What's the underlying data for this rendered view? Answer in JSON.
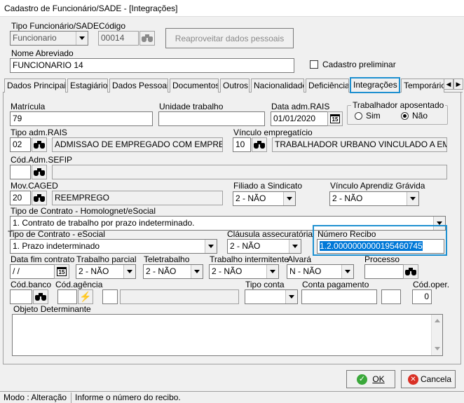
{
  "window": {
    "title": "Cadastro de Funcionário/SADE - [Integrações]"
  },
  "header": {
    "tipo_label": "Tipo Funcionário/SADE",
    "tipo_value": "Funcionario",
    "codigo_label": "Código",
    "codigo_value": "00014",
    "reaproveitar_label": "Reaproveitar dados pessoais",
    "nome_label": "Nome Abreviado",
    "nome_value": "FUNCIONARIO 14",
    "cadastro_preliminar_label": "Cadastro preliminar"
  },
  "tabs": [
    {
      "label": "Dados Principais"
    },
    {
      "label": "Estagiário"
    },
    {
      "label": "Dados Pessoais"
    },
    {
      "label": "Documentos"
    },
    {
      "label": "Outros"
    },
    {
      "label": "Nacionalidade"
    },
    {
      "label": "Deficiência"
    },
    {
      "label": "Integrações"
    },
    {
      "label": "Temporário."
    }
  ],
  "form": {
    "matricula_label": "Matrícula",
    "matricula_value": "79",
    "unidade_label": "Unidade trabalho",
    "unidade_value": "",
    "data_adm_label": "Data adm.RAIS",
    "data_adm_value": "01/01/2020",
    "aposentado_label": "Trabalhador aposentado",
    "sim_label": "Sim",
    "nao_label": "Não",
    "tipo_adm_label": "Tipo adm.RAIS",
    "tipo_adm_code": "02",
    "tipo_adm_desc": "ADMISSAO DE EMPREGADO COM EMPREGO A",
    "vinculo_label": "Vínculo empregatício",
    "vinculo_code": "10",
    "vinculo_desc": "TRABALHADOR URBANO VINCULADO A EMPRE",
    "cod_sefip_label": "Cód.Adm.SEFIP",
    "mov_caged_label": "Mov.CAGED",
    "mov_caged_code": "20",
    "mov_caged_desc": "REEMPREGO",
    "filiado_label": "Filiado a Sindicato",
    "filiado_value": "2 - NÃO",
    "aprendiz_label": "Vínculo Aprendiz Grávida",
    "aprendiz_value": "2 - NÃO",
    "contrato_homolog_label": "Tipo de Contrato - Homolognet/eSocial",
    "contrato_homolog_value": "1. Contrato de trabalho por prazo indeterminado.",
    "contrato_esocial_label": "Tipo de Contrato - eSocial",
    "contrato_esocial_value": "1. Prazo indeterminado",
    "clausula_label": "Cláusula assecuratória",
    "clausula_value": "2 - NÃO",
    "recibo_label": "Número Recibo",
    "recibo_value": "1.2.0000000000195460745",
    "data_fim_label": "Data fim contrato",
    "data_fim_value": " / /",
    "parcial_label": "Trabalho parcial",
    "parcial_value": "2 - NÃO",
    "teletrabalho_label": "Teletrabalho",
    "teletrabalho_value": "2 - NÃO",
    "intermitente_label": "Trabalho intermitente",
    "intermitente_value": "2 - NÃO",
    "alvara_label": "Alvará",
    "alvara_value": "N - NÃO",
    "processo_label": "Processo",
    "cod_banco_label": "Cód.banco",
    "cod_agencia_label": "Cód.agência",
    "tipo_conta_label": "Tipo conta",
    "conta_pagamento_label": "Conta pagamento",
    "cod_oper_label": "Cód.oper.",
    "cod_oper_value": "0",
    "objeto_label": "Objeto Determinante"
  },
  "buttons": {
    "ok": "OK",
    "cancel": "Cancela"
  },
  "status": {
    "mode": "Modo : Alteração",
    "hint": "Informe o número do recibo."
  },
  "colors": {
    "focus_border": "#1e90d0",
    "selection": "#0078d7"
  }
}
